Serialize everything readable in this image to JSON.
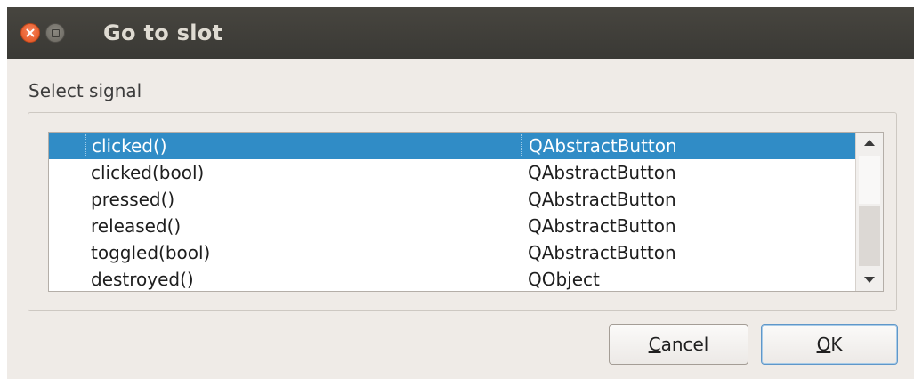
{
  "window": {
    "title": "Go to slot"
  },
  "dialog": {
    "select_label": "Select signal",
    "signals": [
      {
        "signal": "clicked()",
        "class": "QAbstractButton",
        "selected": true
      },
      {
        "signal": "clicked(bool)",
        "class": "QAbstractButton",
        "selected": false
      },
      {
        "signal": "pressed()",
        "class": "QAbstractButton",
        "selected": false
      },
      {
        "signal": "released()",
        "class": "QAbstractButton",
        "selected": false
      },
      {
        "signal": "toggled(bool)",
        "class": "QAbstractButton",
        "selected": false
      },
      {
        "signal": "destroyed()",
        "class": "QObject",
        "selected": false
      }
    ],
    "buttons": {
      "cancel": {
        "mnemonic": "C",
        "rest": "ancel"
      },
      "ok": {
        "mnemonic": "O",
        "rest": "K"
      }
    }
  },
  "icons": [
    "close-icon",
    "maximize-icon",
    "scroll-up-arrow-icon",
    "scroll-down-arrow-icon"
  ],
  "colors": {
    "titlebar": "#3c3b37",
    "selection": "#308cc6",
    "close_button": "#e9541d",
    "window_bg": "#efebe7"
  }
}
